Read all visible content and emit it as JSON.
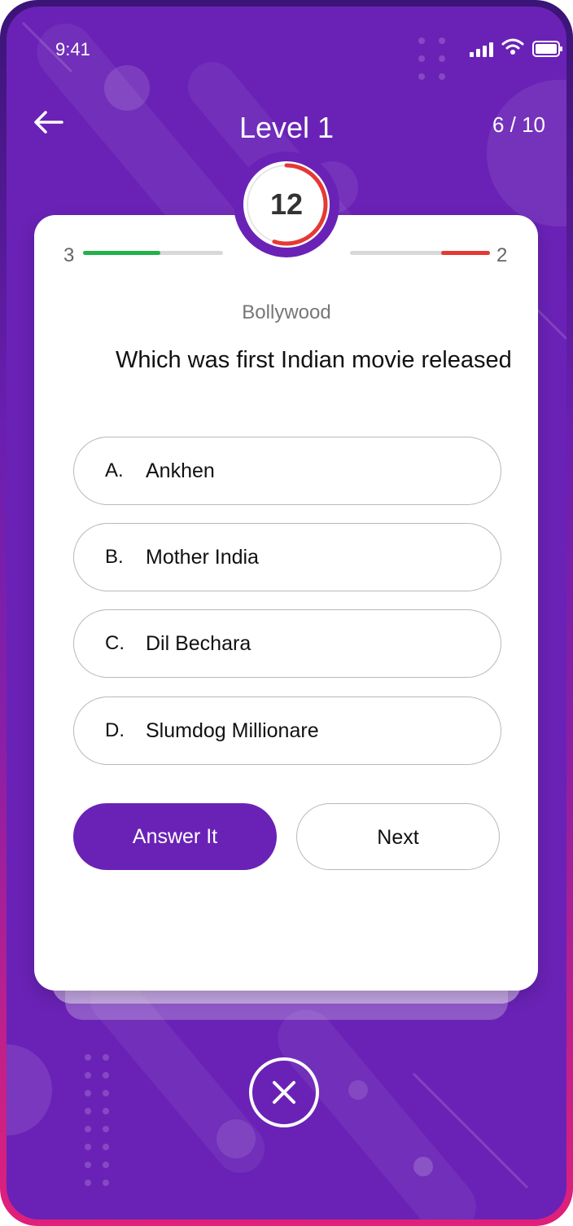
{
  "status_bar": {
    "time": "9:41"
  },
  "header": {
    "title": "Level 1",
    "progress": "6 / 10"
  },
  "timer": {
    "seconds": "12",
    "remaining_fraction": 0.55
  },
  "scores": {
    "correct": "3",
    "wrong": "2",
    "correct_fraction": 0.55,
    "wrong_fraction": 0.35
  },
  "question": {
    "category": "Bollywood",
    "text": "Which was first Indian movie released"
  },
  "options": [
    {
      "letter": "A.",
      "text": "Ankhen"
    },
    {
      "letter": "B.",
      "text": "Mother India"
    },
    {
      "letter": "C.",
      "text": "Dil Bechara"
    },
    {
      "letter": "D.",
      "text": "Slumdog Millionare"
    }
  ],
  "buttons": {
    "answer": "Answer It",
    "next": "Next"
  },
  "colors": {
    "primary": "#6a22b6",
    "correct": "#22b14c",
    "wrong": "#e53935",
    "pink": "#e0207a"
  },
  "icons": {
    "back": "arrow-left-icon",
    "close": "close-icon",
    "signal": "signal-icon",
    "wifi": "wifi-icon",
    "battery": "battery-icon"
  }
}
